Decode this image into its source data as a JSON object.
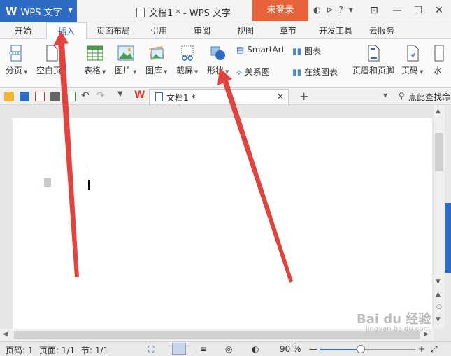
{
  "app": {
    "logo": "W",
    "name": "WPS 文字"
  },
  "window": {
    "title": "文档1 * - WPS 文字",
    "login": "未登录",
    "help": "?"
  },
  "tabs": [
    "开始",
    "插入",
    "页面布局",
    "引用",
    "审阅",
    "视图",
    "章节",
    "开发工具",
    "云服务"
  ],
  "active_tab": "插入",
  "ribbon": {
    "page_break": "分页",
    "blank_page": "空白页",
    "table": "表格",
    "picture": "图片",
    "gallery": "图库",
    "screenshot": "截屏",
    "shape": "形状",
    "smartart": "SmartArt",
    "chart": "图表",
    "relation": "关系图",
    "online_chart": "在线图表",
    "header_footer": "页眉和页脚",
    "page_number": "页码",
    "watermark": "水"
  },
  "quickbar": {
    "doc_tab": "文档1 *",
    "search": "点此查找命令"
  },
  "status": {
    "page_no": "页码: 1",
    "pages": "页面: 1/1",
    "section": "节: 1/1",
    "zoom": "90 %"
  },
  "watermark_text": {
    "brand": "Bai du 经验",
    "url": "jingyan.baidu.com"
  },
  "colors": {
    "accent": "#2d6bc4",
    "login": "#e8633a",
    "arrow": "#e2433d"
  }
}
